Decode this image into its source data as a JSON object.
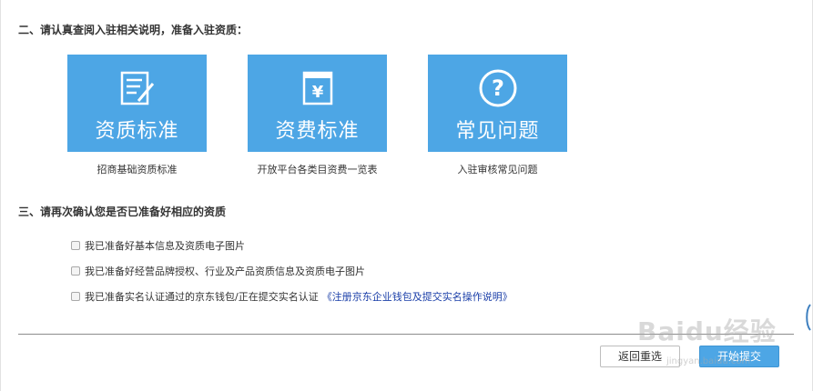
{
  "section2": {
    "title": "二、请认真查阅入驻相关说明，准备入驻资质："
  },
  "cards": [
    {
      "title": "资质标准",
      "caption": "招商基础资质标准",
      "icon": "document-edit-icon"
    },
    {
      "title": "资费标准",
      "caption": "开放平台各类目资费一览表",
      "icon": "yen-receipt-icon"
    },
    {
      "title": "常见问题",
      "caption": "入驻审核常见问题",
      "icon": "question-circle-icon"
    }
  ],
  "section3": {
    "title": "三、请再次确认您是否已准备好相应的资质",
    "checks": [
      {
        "label": "我已准备好基本信息及资质电子图片",
        "checked": false
      },
      {
        "label": "我已准备好经营品牌授权、行业及产品资质信息及资质电子图片",
        "checked": false
      },
      {
        "label": "我已准备实名认证通过的京东钱包/正在提交实名认证",
        "checked": false,
        "link": "《注册京东企业钱包及提交实名操作说明》"
      }
    ]
  },
  "buttons": {
    "back": "返回重选",
    "submit": "开始提交"
  },
  "watermark": {
    "text": "Baidu经验",
    "sub": "jingyan.baidu.com"
  },
  "colors": {
    "card_bg": "#4da6e5",
    "link": "#1a3ea8",
    "primary_button": "#4da6e5"
  }
}
